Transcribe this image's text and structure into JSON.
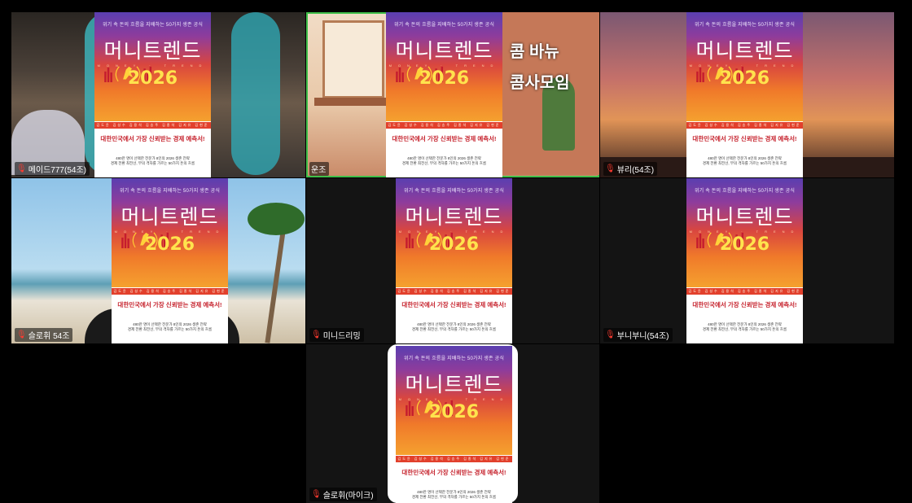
{
  "book": {
    "tagline": "위기 속 돈의 흐름을 지배하는 50가지 생존 공식",
    "title": "머니트렌드",
    "money_trend": "MONEY · TREND",
    "year": "2026",
    "authors": "김도윤 김성수 김용석 김승주 김종석 김지유 김현준 정의재",
    "subtitle": "대한민국에서 가장 신뢰받는 경제 예측서!",
    "desc_line1": "480만 명이 선택한 전문가 8인의 2026 생존 전략",
    "desc_line2": "경제 전환 최전선, 부의 격차를 가르는 50가지 돈의 흐름"
  },
  "participants": [
    {
      "name": "메이드777(54조)"
    },
    {
      "name": "운조"
    },
    {
      "name": "뷰리(54조)"
    },
    {
      "name": "슬로휘 54조"
    },
    {
      "name": "미니드리밍"
    },
    {
      "name": "부니부니(54조)"
    },
    {
      "name": "슬로휘(마이크)"
    }
  ],
  "overlay": {
    "line1": "콤 바뉴",
    "line2": "콤사모임"
  },
  "colors": {
    "active_speaker_border": "#3fbf4a",
    "mic_muted": "#ff3b30"
  }
}
